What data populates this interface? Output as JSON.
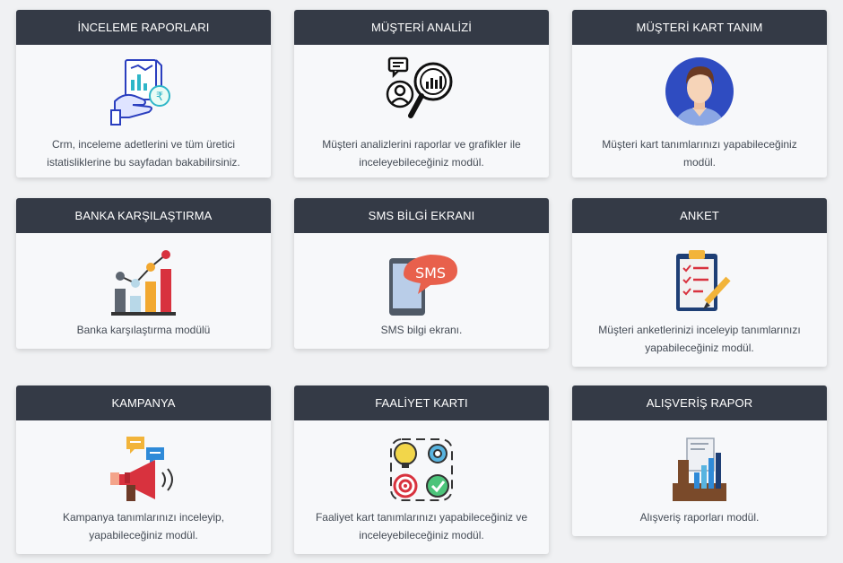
{
  "cards": [
    {
      "title": "İNCELEME RAPORLARI",
      "desc": "Crm, inceleme adetlerini ve tüm üretici istatisliklerine bu sayfadan bakabilirsiniz.",
      "icon": "hand-report-icon"
    },
    {
      "title": "MÜŞTERİ ANALİZİ",
      "desc": "Müşteri analizlerini raporlar ve grafikler ile inceleyebileceğiniz modül.",
      "icon": "customer-analysis-icon"
    },
    {
      "title": "MÜŞTERİ KART TANIM",
      "desc": "Müşteri kart tanımlarınızı yapabileceğiniz modül.",
      "icon": "customer-avatar-icon"
    },
    {
      "title": "BANKA KARŞILAŞTIRMA",
      "desc": "Banka karşılaştırma modülü",
      "icon": "bar-chart-icon"
    },
    {
      "title": "SMS BİLGİ EKRANI",
      "desc": "SMS bilgi ekranı.",
      "icon": "sms-phone-icon"
    },
    {
      "title": "ANKET",
      "desc": "Müşteri anketlerinizi inceleyip tanımlarınızı yapabileceğiniz modül.",
      "icon": "survey-clipboard-icon"
    },
    {
      "title": "KAMPANYA",
      "desc": "Kampanya tanımlarınızı inceleyip, yapabileceğiniz modül.",
      "icon": "megaphone-icon"
    },
    {
      "title": "FAALİYET KARTI",
      "desc": "Faaliyet kart tanımlarınızı yapabileceğiniz ve inceleyebileceğiniz modül.",
      "icon": "activity-cycle-icon"
    },
    {
      "title": "ALIŞVERİŞ RAPOR",
      "desc": "Alışveriş raporları modül.",
      "icon": "shopping-report-icon"
    }
  ],
  "sms_icon_text": "SMS"
}
